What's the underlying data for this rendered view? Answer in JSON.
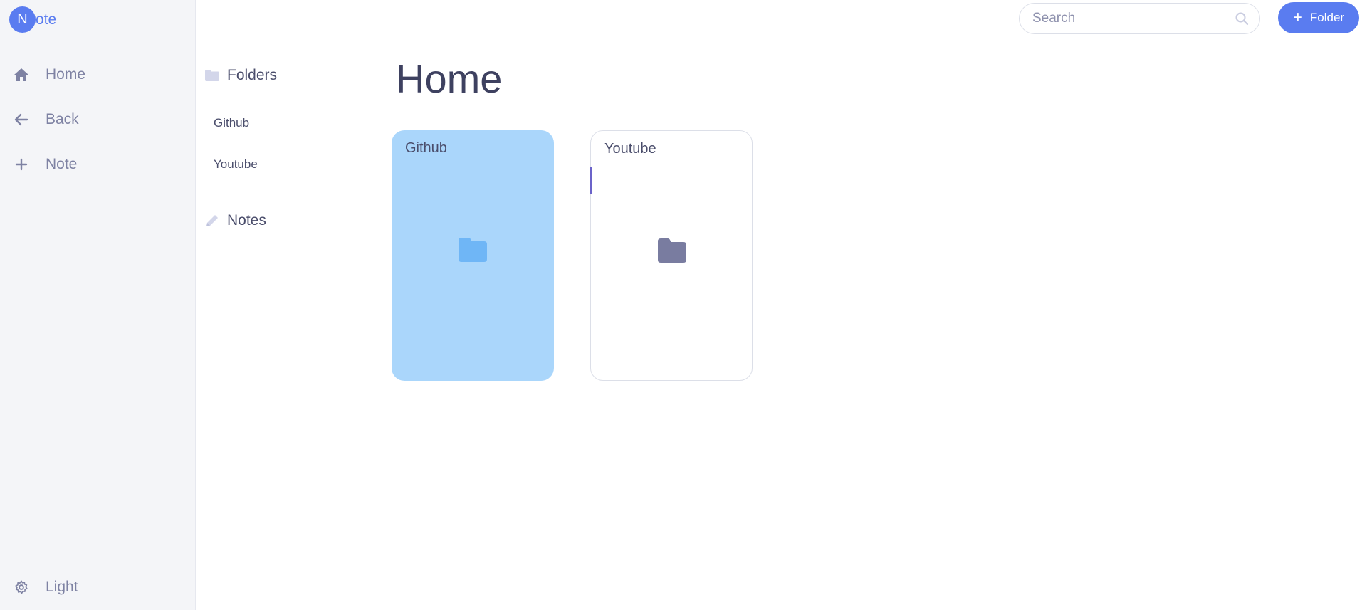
{
  "app": {
    "logo_letter": "N",
    "logo_text": "ote"
  },
  "sidebar": {
    "items": [
      {
        "label": "Home",
        "icon": "home-icon"
      },
      {
        "label": "Back",
        "icon": "arrow-left-icon"
      },
      {
        "label": "Note",
        "icon": "plus-icon"
      }
    ],
    "theme_toggle": {
      "label": "Light",
      "icon": "gear-icon"
    }
  },
  "panel": {
    "folders_heading": "Folders",
    "folders": [
      "Github",
      "Youtube"
    ],
    "notes_heading": "Notes"
  },
  "topbar": {
    "search_placeholder": "Search",
    "add_folder_label": "Folder"
  },
  "main": {
    "title": "Home",
    "cards": [
      {
        "title": "Github",
        "selected": true
      },
      {
        "title": "Youtube",
        "selected": false
      }
    ]
  },
  "colors": {
    "accent": "#5a7cf0",
    "selected_card": "#aad6fb",
    "selected_folder_icon": "#6fb6f6",
    "folder_icon": "#797ca0",
    "sidebar_bg": "#f4f5f8"
  }
}
